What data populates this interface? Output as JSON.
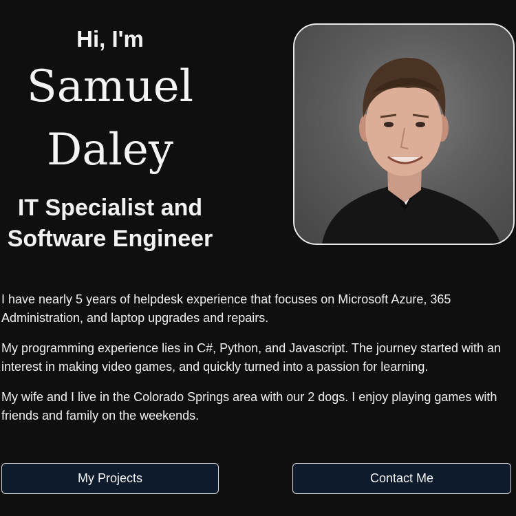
{
  "hero": {
    "greeting": "Hi, I'm",
    "name_first": "Samuel",
    "name_last": "Daley",
    "role_line1": "IT Specialist and",
    "role_line2": "Software Engineer"
  },
  "profile_photo": {
    "icon": "person-portrait",
    "alt": "Samuel Daley"
  },
  "about": {
    "paragraphs": [
      "I have nearly 5 years of helpdesk experience that focuses on Microsoft Azure, 365 Administration, and laptop upgrades and repairs.",
      "My programming experience lies in C#, Python, and Javascript. The journey started with an interest in making video games, and quickly turned into a passion for learning.",
      "My wife and I live in the Colorado Springs area with our 2 dogs. I enjoy playing games with friends and family on the weekends."
    ]
  },
  "actions": {
    "projects_label": "My Projects",
    "contact_label": "Contact Me"
  },
  "colors": {
    "background": "#0f0f10",
    "button_bg": "#0e1b2c",
    "text": "#f2f2f2"
  }
}
